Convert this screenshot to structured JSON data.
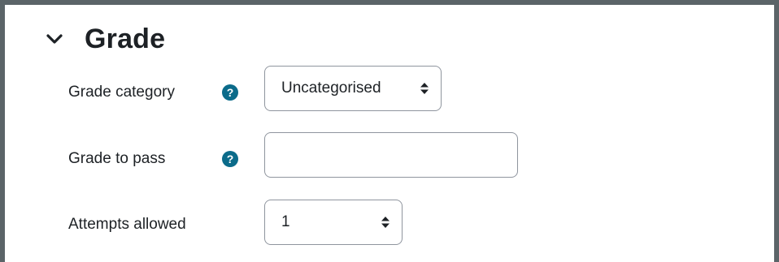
{
  "section": {
    "title": "Grade"
  },
  "fields": {
    "grade_category": {
      "label": "Grade category",
      "value": "Uncategorised"
    },
    "grade_to_pass": {
      "label": "Grade to pass",
      "value": ""
    },
    "attempts_allowed": {
      "label": "Attempts allowed",
      "value": "1"
    }
  },
  "icons": {
    "collapse": "chevron-down-icon",
    "help": "question-circle-icon",
    "select_arrows": "sort-arrows-icon"
  },
  "colors": {
    "help_icon": "#0b6b8a",
    "border": "#8f959e",
    "frame": "#5b6468"
  }
}
